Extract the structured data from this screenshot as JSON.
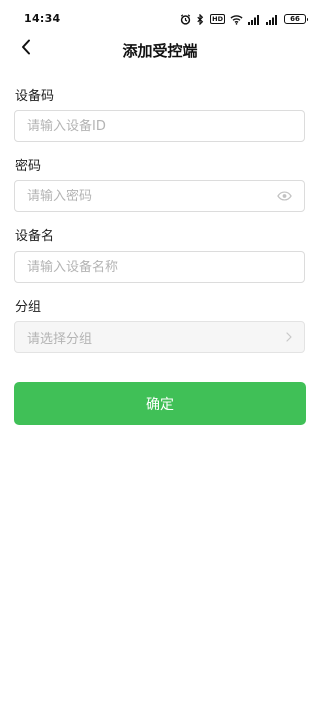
{
  "status_bar": {
    "time": "14:34",
    "hd_label": "HD",
    "battery_level": "66",
    "icons": [
      "alarm-icon",
      "bluetooth-icon",
      "hd-icon",
      "wifi-icon",
      "signal-icon",
      "signal-icon",
      "battery-icon"
    ]
  },
  "nav": {
    "back_icon": "chevron-left-icon",
    "title": "添加受控端"
  },
  "form": {
    "device_code": {
      "label": "设备码",
      "placeholder": "请输入设备ID",
      "value": ""
    },
    "password": {
      "label": "密码",
      "placeholder": "请输入密码",
      "value": "",
      "toggle_icon": "eye-icon"
    },
    "device_name": {
      "label": "设备名",
      "placeholder": "请输入设备名称",
      "value": ""
    },
    "group": {
      "label": "分组",
      "placeholder": "请选择分组",
      "chevron_icon": "chevron-right-icon"
    }
  },
  "confirm_button": {
    "label": "确定"
  },
  "colors": {
    "accent": "#40c057",
    "border": "#dcdcdc",
    "placeholder": "#b4b4b4",
    "disabled_bg": "#f6f6f6"
  }
}
